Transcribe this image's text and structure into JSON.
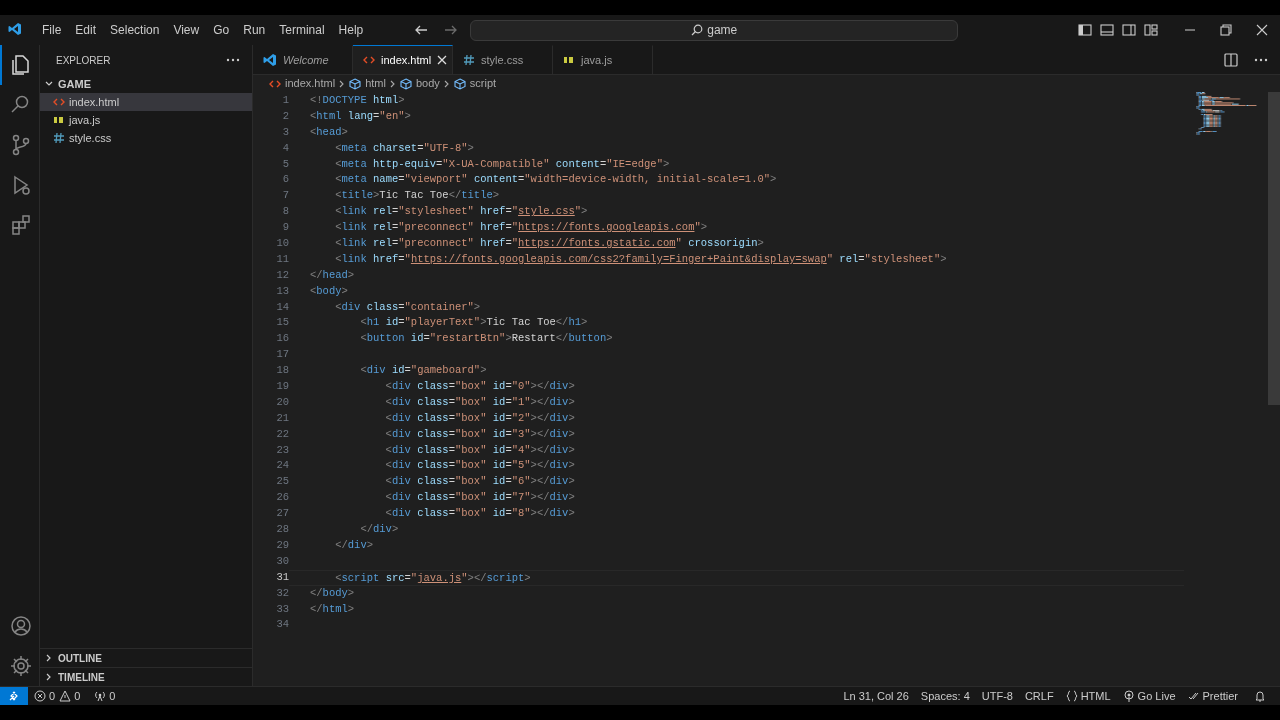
{
  "title_bar": {
    "menus": [
      "File",
      "Edit",
      "Selection",
      "View",
      "Go",
      "Run",
      "Terminal",
      "Help"
    ],
    "search": "game"
  },
  "activity_bar": {
    "items": [
      {
        "kind": "explorer",
        "selected": true
      },
      {
        "kind": "search",
        "selected": false
      },
      {
        "kind": "source-control",
        "selected": false
      },
      {
        "kind": "run",
        "selected": false
      },
      {
        "kind": "extensions",
        "selected": false
      }
    ],
    "bottom": [
      {
        "kind": "account"
      },
      {
        "kind": "settings"
      }
    ]
  },
  "sidebar": {
    "title": "EXPLORER",
    "folder": {
      "name": "GAME",
      "expanded": true,
      "files": [
        {
          "name": "index.html",
          "kind": "html",
          "selected": true
        },
        {
          "name": "java.js",
          "kind": "js",
          "selected": false
        },
        {
          "name": "style.css",
          "kind": "css",
          "selected": false
        }
      ]
    },
    "sections": [
      {
        "label": "OUTLINE",
        "expanded": false
      },
      {
        "label": "TIMELINE",
        "expanded": false
      }
    ]
  },
  "tabs": [
    {
      "label": "Welcome",
      "kind": "welcome",
      "selected": false
    },
    {
      "label": "index.html",
      "kind": "html",
      "selected": true
    },
    {
      "label": "style.css",
      "kind": "css",
      "selected": false
    },
    {
      "label": "java.js",
      "kind": "js",
      "selected": false
    }
  ],
  "breadcrumb": [
    {
      "label": "index.html",
      "kind": "html"
    },
    {
      "label": "html",
      "kind": "symbol"
    },
    {
      "label": "body",
      "kind": "symbol"
    },
    {
      "label": "script",
      "kind": "symbol"
    }
  ],
  "editor": {
    "lines": [
      {
        "number": "1",
        "current": false,
        "tokens": [
          {
            "kind": "punct",
            "text": "<!"
          },
          {
            "kind": "tag",
            "text": "DOCTYPE"
          },
          {
            "kind": "attr",
            "text": " html"
          },
          {
            "kind": "punct",
            "text": ">"
          }
        ]
      },
      {
        "number": "2",
        "current": false,
        "tokens": [
          {
            "kind": "punct",
            "text": "<"
          },
          {
            "kind": "tag",
            "text": "html"
          },
          {
            "kind": "attr",
            "text": " lang"
          },
          {
            "kind": "text",
            "text": "="
          },
          {
            "kind": "string",
            "text": "\"en\""
          },
          {
            "kind": "punct",
            "text": ">"
          }
        ]
      },
      {
        "number": "3",
        "current": false,
        "tokens": [
          {
            "kind": "punct",
            "text": "<"
          },
          {
            "kind": "tag",
            "text": "head"
          },
          {
            "kind": "punct",
            "text": ">"
          }
        ]
      },
      {
        "number": "4",
        "current": false,
        "tokens": [
          {
            "kind": "punct",
            "text": "    <"
          },
          {
            "kind": "tag",
            "text": "meta"
          },
          {
            "kind": "attr",
            "text": " charset"
          },
          {
            "kind": "text",
            "text": "="
          },
          {
            "kind": "string",
            "text": "\"UTF-8\""
          },
          {
            "kind": "punct",
            "text": ">"
          }
        ]
      },
      {
        "number": "5",
        "current": false,
        "tokens": [
          {
            "kind": "punct",
            "text": "    <"
          },
          {
            "kind": "tag",
            "text": "meta"
          },
          {
            "kind": "attr",
            "text": " http-equiv"
          },
          {
            "kind": "text",
            "text": "="
          },
          {
            "kind": "string",
            "text": "\"X-UA-Compatible\""
          },
          {
            "kind": "attr",
            "text": " content"
          },
          {
            "kind": "text",
            "text": "="
          },
          {
            "kind": "string",
            "text": "\"IE=edge\""
          },
          {
            "kind": "punct",
            "text": ">"
          }
        ]
      },
      {
        "number": "6",
        "current": false,
        "tokens": [
          {
            "kind": "punct",
            "text": "    <"
          },
          {
            "kind": "tag",
            "text": "meta"
          },
          {
            "kind": "attr",
            "text": " name"
          },
          {
            "kind": "text",
            "text": "="
          },
          {
            "kind": "string",
            "text": "\"viewport\""
          },
          {
            "kind": "attr",
            "text": " content"
          },
          {
            "kind": "text",
            "text": "="
          },
          {
            "kind": "string",
            "text": "\"width=device-width, initial-scale=1.0\""
          },
          {
            "kind": "punct",
            "text": ">"
          }
        ]
      },
      {
        "number": "7",
        "current": false,
        "tokens": [
          {
            "kind": "punct",
            "text": "    <"
          },
          {
            "kind": "tag",
            "text": "title"
          },
          {
            "kind": "punct",
            "text": ">"
          },
          {
            "kind": "text",
            "text": "Tic Tac Toe"
          },
          {
            "kind": "punct",
            "text": "</"
          },
          {
            "kind": "tag",
            "text": "title"
          },
          {
            "kind": "punct",
            "text": ">"
          }
        ]
      },
      {
        "number": "8",
        "current": false,
        "tokens": [
          {
            "kind": "punct",
            "text": "    <"
          },
          {
            "kind": "tag",
            "text": "link"
          },
          {
            "kind": "attr",
            "text": " rel"
          },
          {
            "kind": "text",
            "text": "="
          },
          {
            "kind": "string",
            "text": "\"stylesheet\""
          },
          {
            "kind": "attr",
            "text": " href"
          },
          {
            "kind": "text",
            "text": "="
          },
          {
            "kind": "string",
            "text": "\""
          },
          {
            "kind": "link",
            "text": "style.css"
          },
          {
            "kind": "string",
            "text": "\""
          },
          {
            "kind": "punct",
            "text": ">"
          }
        ]
      },
      {
        "number": "9",
        "current": false,
        "tokens": [
          {
            "kind": "punct",
            "text": "    <"
          },
          {
            "kind": "tag",
            "text": "link"
          },
          {
            "kind": "attr",
            "text": " rel"
          },
          {
            "kind": "text",
            "text": "="
          },
          {
            "kind": "string",
            "text": "\"preconnect\""
          },
          {
            "kind": "attr",
            "text": " href"
          },
          {
            "kind": "text",
            "text": "="
          },
          {
            "kind": "string",
            "text": "\""
          },
          {
            "kind": "link",
            "text": "https://fonts.googleapis.com"
          },
          {
            "kind": "string",
            "text": "\""
          },
          {
            "kind": "punct",
            "text": ">"
          }
        ]
      },
      {
        "number": "10",
        "current": false,
        "tokens": [
          {
            "kind": "punct",
            "text": "    <"
          },
          {
            "kind": "tag",
            "text": "link"
          },
          {
            "kind": "attr",
            "text": " rel"
          },
          {
            "kind": "text",
            "text": "="
          },
          {
            "kind": "string",
            "text": "\"preconnect\""
          },
          {
            "kind": "attr",
            "text": " href"
          },
          {
            "kind": "text",
            "text": "="
          },
          {
            "kind": "string",
            "text": "\""
          },
          {
            "kind": "link",
            "text": "https://fonts.gstatic.com"
          },
          {
            "kind": "string",
            "text": "\""
          },
          {
            "kind": "attr",
            "text": " crossorigin"
          },
          {
            "kind": "punct",
            "text": ">"
          }
        ]
      },
      {
        "number": "11",
        "current": false,
        "tokens": [
          {
            "kind": "punct",
            "text": "    <"
          },
          {
            "kind": "tag",
            "text": "link"
          },
          {
            "kind": "attr",
            "text": " href"
          },
          {
            "kind": "text",
            "text": "="
          },
          {
            "kind": "string",
            "text": "\""
          },
          {
            "kind": "link",
            "text": "https://fonts.googleapis.com/css2?family=Finger+Paint&display=swap"
          },
          {
            "kind": "string",
            "text": "\""
          },
          {
            "kind": "attr",
            "text": " rel"
          },
          {
            "kind": "text",
            "text": "="
          },
          {
            "kind": "string",
            "text": "\"stylesheet\""
          },
          {
            "kind": "punct",
            "text": ">"
          }
        ]
      },
      {
        "number": "12",
        "current": false,
        "tokens": [
          {
            "kind": "punct",
            "text": "</"
          },
          {
            "kind": "tag",
            "text": "head"
          },
          {
            "kind": "punct",
            "text": ">"
          }
        ]
      },
      {
        "number": "13",
        "current": false,
        "tokens": [
          {
            "kind": "punct",
            "text": "<"
          },
          {
            "kind": "tag",
            "text": "body"
          },
          {
            "kind": "punct",
            "text": ">"
          }
        ]
      },
      {
        "number": "14",
        "current": false,
        "tokens": [
          {
            "kind": "punct",
            "text": "    <"
          },
          {
            "kind": "tag",
            "text": "div"
          },
          {
            "kind": "attr",
            "text": " class"
          },
          {
            "kind": "text",
            "text": "="
          },
          {
            "kind": "string",
            "text": "\"container\""
          },
          {
            "kind": "punct",
            "text": ">"
          }
        ]
      },
      {
        "number": "15",
        "current": false,
        "tokens": [
          {
            "kind": "punct",
            "text": "        <"
          },
          {
            "kind": "tag",
            "text": "h1"
          },
          {
            "kind": "attr",
            "text": " id"
          },
          {
            "kind": "text",
            "text": "="
          },
          {
            "kind": "string",
            "text": "\"playerText\""
          },
          {
            "kind": "punct",
            "text": ">"
          },
          {
            "kind": "text",
            "text": "Tic Tac Toe"
          },
          {
            "kind": "punct",
            "text": "</"
          },
          {
            "kind": "tag",
            "text": "h1"
          },
          {
            "kind": "punct",
            "text": ">"
          }
        ]
      },
      {
        "number": "16",
        "current": false,
        "tokens": [
          {
            "kind": "punct",
            "text": "        <"
          },
          {
            "kind": "tag",
            "text": "button"
          },
          {
            "kind": "attr",
            "text": " id"
          },
          {
            "kind": "text",
            "text": "="
          },
          {
            "kind": "string",
            "text": "\"restartBtn\""
          },
          {
            "kind": "punct",
            "text": ">"
          },
          {
            "kind": "text",
            "text": "Restart"
          },
          {
            "kind": "punct",
            "text": "</"
          },
          {
            "kind": "tag",
            "text": "button"
          },
          {
            "kind": "punct",
            "text": ">"
          }
        ]
      },
      {
        "number": "17",
        "current": false
      },
      {
        "number": "18",
        "current": false,
        "tokens": [
          {
            "kind": "punct",
            "text": "        <"
          },
          {
            "kind": "tag",
            "text": "div"
          },
          {
            "kind": "attr",
            "text": " id"
          },
          {
            "kind": "text",
            "text": "="
          },
          {
            "kind": "string",
            "text": "\"gameboard\""
          },
          {
            "kind": "punct",
            "text": ">"
          }
        ]
      },
      {
        "number": "19",
        "current": false,
        "tokens": [
          {
            "kind": "punct",
            "text": "            <"
          },
          {
            "kind": "tag",
            "text": "div"
          },
          {
            "kind": "attr",
            "text": " class"
          },
          {
            "kind": "text",
            "text": "="
          },
          {
            "kind": "string",
            "text": "\"box\""
          },
          {
            "kind": "attr",
            "text": " id"
          },
          {
            "kind": "text",
            "text": "="
          },
          {
            "kind": "string",
            "text": "\"0\""
          },
          {
            "kind": "punct",
            "text": "></"
          },
          {
            "kind": "tag",
            "text": "div"
          },
          {
            "kind": "punct",
            "text": ">"
          }
        ]
      },
      {
        "number": "20",
        "current": false,
        "tokens": [
          {
            "kind": "punct",
            "text": "            <"
          },
          {
            "kind": "tag",
            "text": "div"
          },
          {
            "kind": "attr",
            "text": " class"
          },
          {
            "kind": "text",
            "text": "="
          },
          {
            "kind": "string",
            "text": "\"box\""
          },
          {
            "kind": "attr",
            "text": " id"
          },
          {
            "kind": "text",
            "text": "="
          },
          {
            "kind": "string",
            "text": "\"1\""
          },
          {
            "kind": "punct",
            "text": "></"
          },
          {
            "kind": "tag",
            "text": "div"
          },
          {
            "kind": "punct",
            "text": ">"
          }
        ]
      },
      {
        "number": "21",
        "current": false,
        "tokens": [
          {
            "kind": "punct",
            "text": "            <"
          },
          {
            "kind": "tag",
            "text": "div"
          },
          {
            "kind": "attr",
            "text": " class"
          },
          {
            "kind": "text",
            "text": "="
          },
          {
            "kind": "string",
            "text": "\"box\""
          },
          {
            "kind": "attr",
            "text": " id"
          },
          {
            "kind": "text",
            "text": "="
          },
          {
            "kind": "string",
            "text": "\"2\""
          },
          {
            "kind": "punct",
            "text": "></"
          },
          {
            "kind": "tag",
            "text": "div"
          },
          {
            "kind": "punct",
            "text": ">"
          }
        ]
      },
      {
        "number": "22",
        "current": false,
        "tokens": [
          {
            "kind": "punct",
            "text": "            <"
          },
          {
            "kind": "tag",
            "text": "div"
          },
          {
            "kind": "attr",
            "text": " class"
          },
          {
            "kind": "text",
            "text": "="
          },
          {
            "kind": "string",
            "text": "\"box\""
          },
          {
            "kind": "attr",
            "text": " id"
          },
          {
            "kind": "text",
            "text": "="
          },
          {
            "kind": "string",
            "text": "\"3\""
          },
          {
            "kind": "punct",
            "text": "></"
          },
          {
            "kind": "tag",
            "text": "div"
          },
          {
            "kind": "punct",
            "text": ">"
          }
        ]
      },
      {
        "number": "23",
        "current": false,
        "tokens": [
          {
            "kind": "punct",
            "text": "            <"
          },
          {
            "kind": "tag",
            "text": "div"
          },
          {
            "kind": "attr",
            "text": " class"
          },
          {
            "kind": "text",
            "text": "="
          },
          {
            "kind": "string",
            "text": "\"box\""
          },
          {
            "kind": "attr",
            "text": " id"
          },
          {
            "kind": "text",
            "text": "="
          },
          {
            "kind": "string",
            "text": "\"4\""
          },
          {
            "kind": "punct",
            "text": "></"
          },
          {
            "kind": "tag",
            "text": "div"
          },
          {
            "kind": "punct",
            "text": ">"
          }
        ]
      },
      {
        "number": "24",
        "current": false,
        "tokens": [
          {
            "kind": "punct",
            "text": "            <"
          },
          {
            "kind": "tag",
            "text": "div"
          },
          {
            "kind": "attr",
            "text": " class"
          },
          {
            "kind": "text",
            "text": "="
          },
          {
            "kind": "string",
            "text": "\"box\""
          },
          {
            "kind": "attr",
            "text": " id"
          },
          {
            "kind": "text",
            "text": "="
          },
          {
            "kind": "string",
            "text": "\"5\""
          },
          {
            "kind": "punct",
            "text": "></"
          },
          {
            "kind": "tag",
            "text": "div"
          },
          {
            "kind": "punct",
            "text": ">"
          }
        ]
      },
      {
        "number": "25",
        "current": false,
        "tokens": [
          {
            "kind": "punct",
            "text": "            <"
          },
          {
            "kind": "tag",
            "text": "div"
          },
          {
            "kind": "attr",
            "text": " class"
          },
          {
            "kind": "text",
            "text": "="
          },
          {
            "kind": "string",
            "text": "\"box\""
          },
          {
            "kind": "attr",
            "text": " id"
          },
          {
            "kind": "text",
            "text": "="
          },
          {
            "kind": "string",
            "text": "\"6\""
          },
          {
            "kind": "punct",
            "text": "></"
          },
          {
            "kind": "tag",
            "text": "div"
          },
          {
            "kind": "punct",
            "text": ">"
          }
        ]
      },
      {
        "number": "26",
        "current": false,
        "tokens": [
          {
            "kind": "punct",
            "text": "            <"
          },
          {
            "kind": "tag",
            "text": "div"
          },
          {
            "kind": "attr",
            "text": " class"
          },
          {
            "kind": "text",
            "text": "="
          },
          {
            "kind": "string",
            "text": "\"box\""
          },
          {
            "kind": "attr",
            "text": " id"
          },
          {
            "kind": "text",
            "text": "="
          },
          {
            "kind": "string",
            "text": "\"7\""
          },
          {
            "kind": "punct",
            "text": "></"
          },
          {
            "kind": "tag",
            "text": "div"
          },
          {
            "kind": "punct",
            "text": ">"
          }
        ]
      },
      {
        "number": "27",
        "current": false,
        "tokens": [
          {
            "kind": "punct",
            "text": "            <"
          },
          {
            "kind": "tag",
            "text": "div"
          },
          {
            "kind": "attr",
            "text": " class"
          },
          {
            "kind": "text",
            "text": "="
          },
          {
            "kind": "string",
            "text": "\"box\""
          },
          {
            "kind": "attr",
            "text": " id"
          },
          {
            "kind": "text",
            "text": "="
          },
          {
            "kind": "string",
            "text": "\"8\""
          },
          {
            "kind": "punct",
            "text": "></"
          },
          {
            "kind": "tag",
            "text": "div"
          },
          {
            "kind": "punct",
            "text": ">"
          }
        ]
      },
      {
        "number": "28",
        "current": false,
        "tokens": [
          {
            "kind": "punct",
            "text": "        </"
          },
          {
            "kind": "tag",
            "text": "div"
          },
          {
            "kind": "punct",
            "text": ">"
          }
        ]
      },
      {
        "number": "29",
        "current": false,
        "tokens": [
          {
            "kind": "punct",
            "text": "    </"
          },
          {
            "kind": "tag",
            "text": "div"
          },
          {
            "kind": "punct",
            "text": ">"
          }
        ]
      },
      {
        "number": "30",
        "current": false
      },
      {
        "number": "31",
        "current": true,
        "tokens": [
          {
            "kind": "punct",
            "text": "    <"
          },
          {
            "kind": "tag",
            "text": "script"
          },
          {
            "kind": "attr",
            "text": " src"
          },
          {
            "kind": "text",
            "text": "="
          },
          {
            "kind": "string",
            "text": "\""
          },
          {
            "kind": "link",
            "text": "java.js"
          },
          {
            "kind": "string",
            "text": "\""
          },
          {
            "kind": "punct",
            "text": "></"
          },
          {
            "kind": "tag",
            "text": "script"
          },
          {
            "kind": "punct",
            "text": ">"
          }
        ]
      },
      {
        "number": "32",
        "current": false,
        "tokens": [
          {
            "kind": "punct",
            "text": "</"
          },
          {
            "kind": "tag",
            "text": "body"
          },
          {
            "kind": "punct",
            "text": ">"
          }
        ]
      },
      {
        "number": "33",
        "current": false,
        "tokens": [
          {
            "kind": "punct",
            "text": "</"
          },
          {
            "kind": "tag",
            "text": "html"
          },
          {
            "kind": "punct",
            "text": ">"
          }
        ]
      },
      {
        "number": "34",
        "current": false
      }
    ]
  },
  "status_bar": {
    "problems": [
      {
        "kind": "error",
        "count": "0"
      },
      {
        "kind": "warning",
        "count": "0"
      },
      {
        "kind": "ports",
        "count": "0"
      }
    ],
    "items": [
      {
        "kind": "text",
        "text": "Ln 31, Col 26"
      },
      {
        "kind": "text",
        "text": "Spaces: 4"
      },
      {
        "kind": "text",
        "text": "UTF-8"
      },
      {
        "kind": "text",
        "text": "CRLF"
      },
      {
        "kind": "language",
        "text": "HTML"
      },
      {
        "kind": "live",
        "text": "Go Live"
      },
      {
        "kind": "check",
        "text": "Prettier"
      },
      {
        "kind": "bell"
      }
    ]
  }
}
